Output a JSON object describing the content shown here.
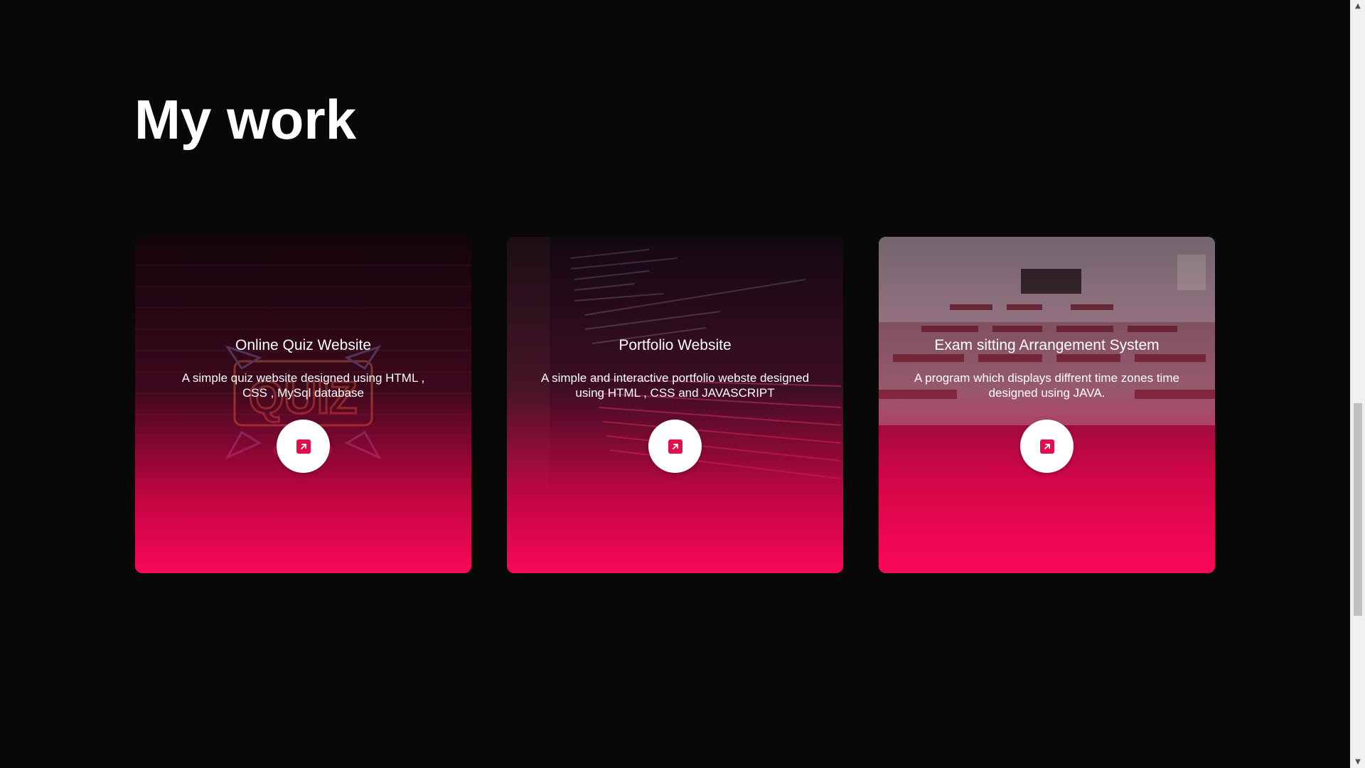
{
  "section": {
    "title": "My work"
  },
  "projects": [
    {
      "title": "Online Quiz Website",
      "description": "A simple quiz website designed using HTML , CSS , MySql database",
      "link_icon": "external-link-icon",
      "image": "neon-quiz-sign"
    },
    {
      "title": "Portfolio Website",
      "description": "A simple and interactive portfolio webste designed using HTML , CSS and JAVASCRIPT",
      "link_icon": "external-link-icon",
      "image": "code-on-screen"
    },
    {
      "title": "Exam sitting Arrangement System",
      "description": "A program which displays diffrent time zones time designed using JAVA.",
      "link_icon": "external-link-icon",
      "image": "empty-classroom"
    }
  ],
  "colors": {
    "background": "#080808",
    "accent": "#f40857",
    "text": "#ffffff"
  },
  "scrollbar": {
    "up_icon": "chevron-up-icon",
    "down_icon": "chevron-down-icon"
  }
}
